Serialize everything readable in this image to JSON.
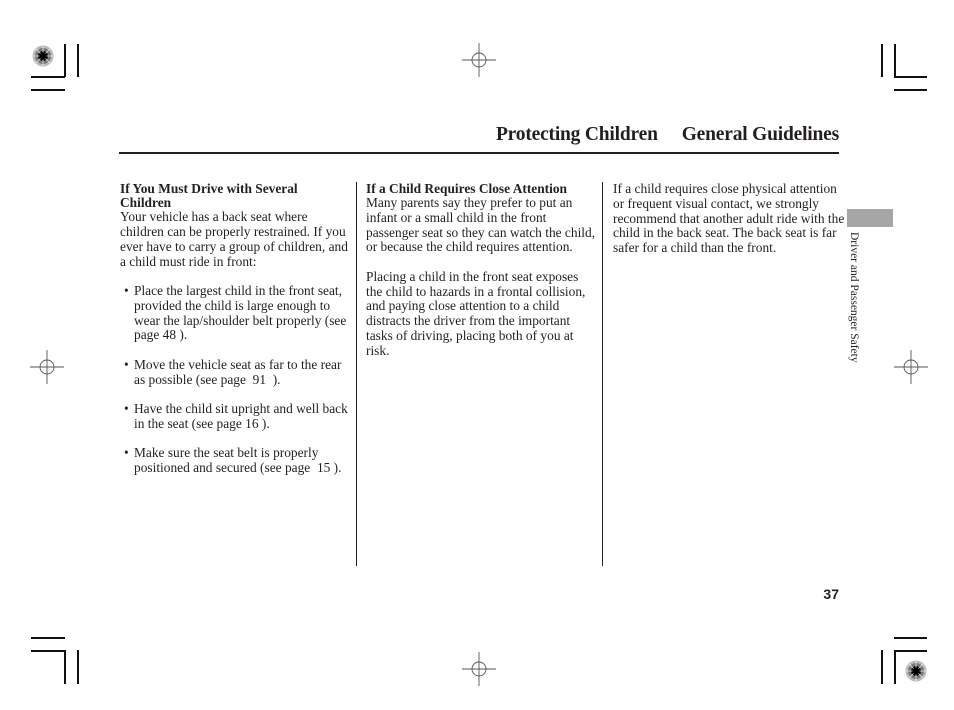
{
  "header": {
    "section_title": "Protecting Children",
    "subsection_title": "General Guidelines"
  },
  "side_tab": {
    "label": "Driver and Passenger Safety",
    "tab_color": "#a6a6a6"
  },
  "page_number": "37",
  "columns": {
    "col1": {
      "heading": "If You Must Drive with Several Children",
      "intro": "Your vehicle has a back seat where children can be properly restrained. If you ever have to carry a group of children, and a child must ride in front:",
      "bullets": [
        "Place the largest child in the front seat, provided the child is large enough to wear the lap/shoulder belt properly (see page 48 ).",
        "Move the vehicle seat as far to the rear as possible (see page  91  ).",
        "Have the child sit upright and well back in the seat (see page 16 ).",
        "Make sure the seat belt is properly positioned and secured (see page  15 )."
      ],
      "bullet_glyph": "•"
    },
    "col2": {
      "heading": "If a Child Requires Close Attention",
      "paragraphs": [
        "Many parents say they prefer to put an infant or a small child in the front passenger seat so they can watch the child, or because the child requires attention.",
        "Placing a child in the front seat exposes the child to hazards in a frontal collision, and paying close attention to a child distracts the driver from the important tasks of driving, placing both of you at risk."
      ]
    },
    "col3": {
      "paragraphs": [
        "If a child requires close physical attention or frequent visual contact, we strongly recommend that another adult ride with the child in the back seat. The back seat is far safer for a child than the front."
      ]
    }
  },
  "print_marks": {
    "crop_marks": "crop-mark-icon",
    "registration_target": "registration-target-icon",
    "crosshair": "crosshair-icon"
  }
}
